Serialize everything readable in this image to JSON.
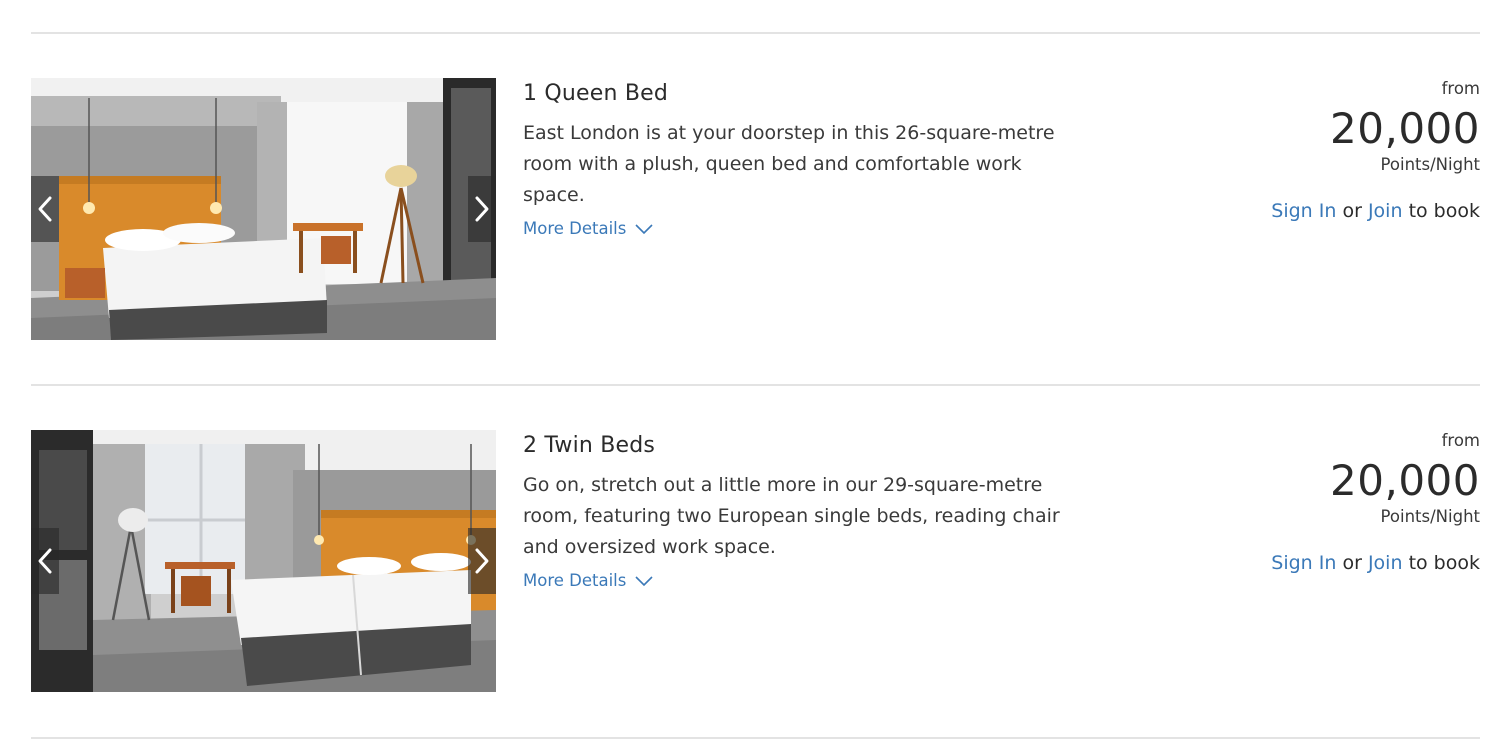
{
  "rooms": [
    {
      "title": "1 Queen Bed",
      "description": "East London is at your doorstep in this 26-square-metre room with a plush, queen bed and comfortable work space.",
      "more_details_label": "More Details",
      "from_label": "from",
      "points": "20,000",
      "unit_label": "Points/Night",
      "sign_in_label": "Sign In",
      "or_label": "or",
      "join_label": "Join",
      "to_book_label": "to book",
      "photo_icons": {
        "prev": "chevron-left-icon",
        "next": "chevron-right-icon",
        "expand": "chevron-down-icon"
      }
    },
    {
      "title": "2 Twin Beds",
      "description": "Go on, stretch out a little more in our 29-square-metre room, featuring two European single beds, reading chair and oversized work space.",
      "more_details_label": "More Details",
      "from_label": "from",
      "points": "20,000",
      "unit_label": "Points/Night",
      "sign_in_label": "Sign In",
      "or_label": "or",
      "join_label": "Join",
      "to_book_label": "to book",
      "photo_icons": {
        "prev": "chevron-left-icon",
        "next": "chevron-right-icon",
        "expand": "chevron-down-icon"
      }
    }
  ],
  "colors": {
    "link": "#3b79b8",
    "text": "#2b2b2b",
    "divider": "#e3e3e3",
    "headboard": "#d98a2b"
  }
}
